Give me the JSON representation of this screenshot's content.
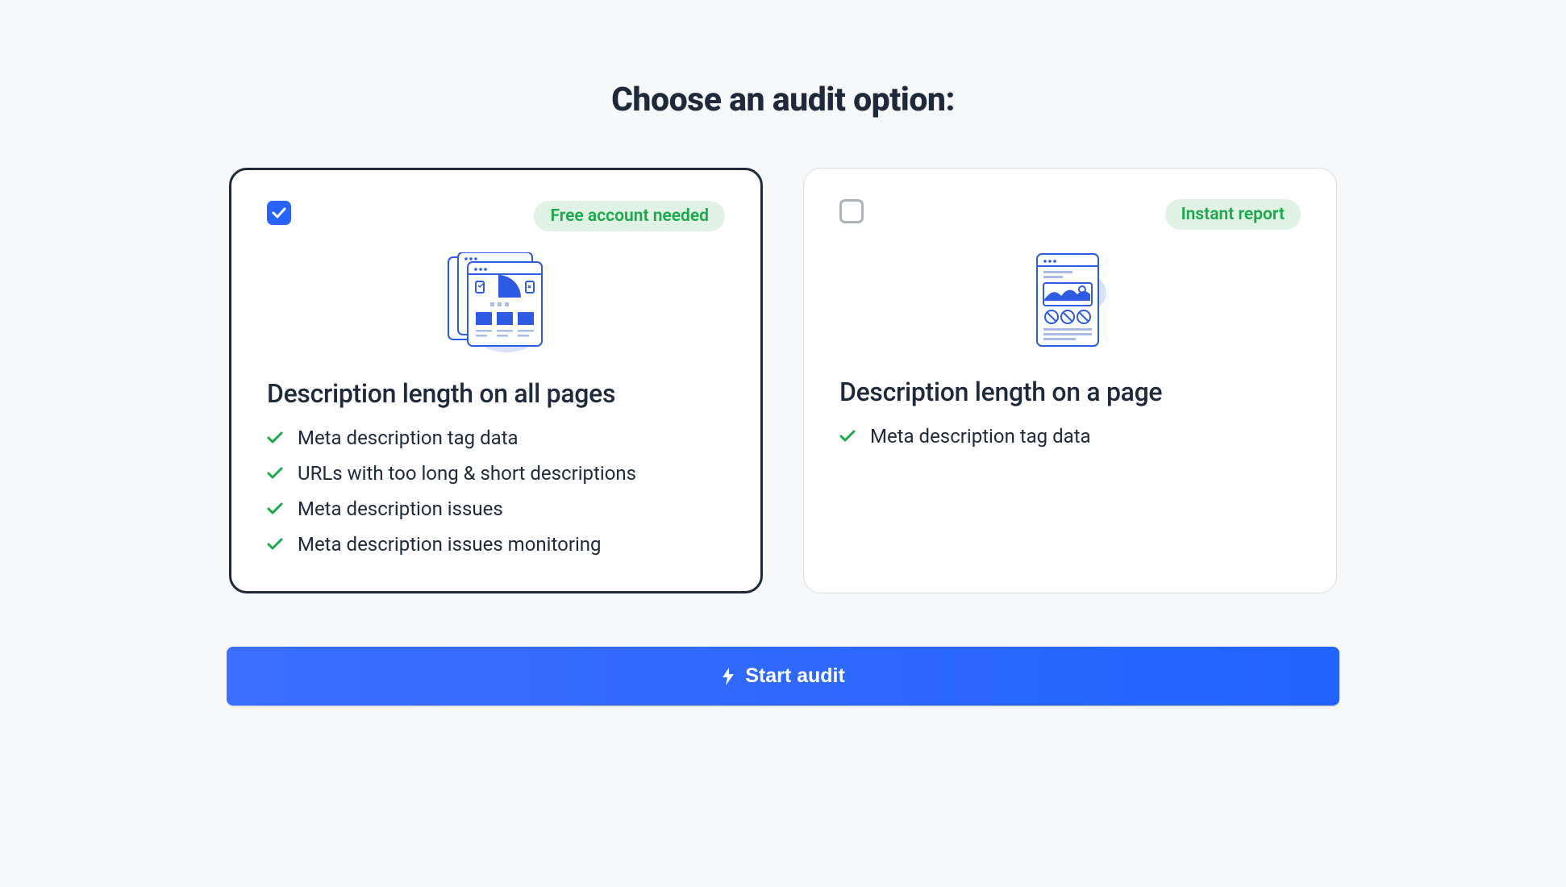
{
  "heading": "Choose an audit option:",
  "options": [
    {
      "selected": true,
      "badge": "Free account needed",
      "title": "Description length on all pages",
      "features": [
        "Meta description tag data",
        "URLs with too long & short descriptions",
        "Meta description issues",
        "Meta description issues monitoring"
      ]
    },
    {
      "selected": false,
      "badge": "Instant report",
      "title": "Description length on a page",
      "features": [
        "Meta description tag data"
      ]
    }
  ],
  "cta_label": "Start audit"
}
